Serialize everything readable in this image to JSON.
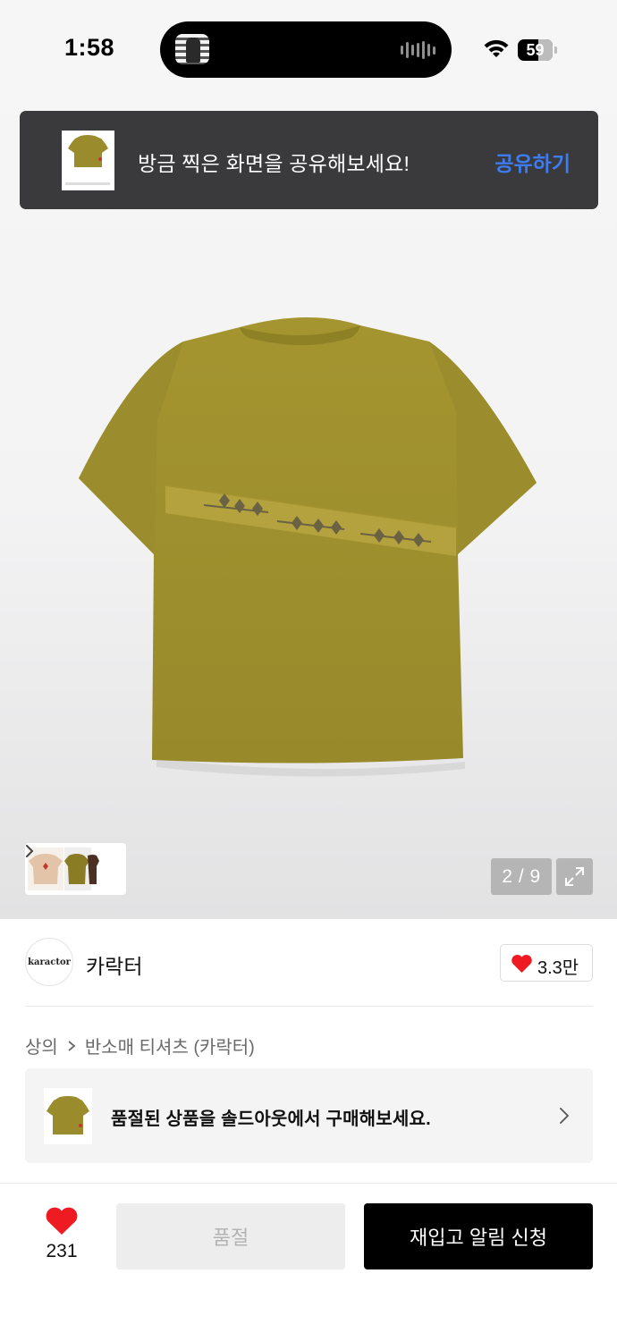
{
  "status_bar": {
    "time": "1:58",
    "battery_level": "59"
  },
  "share_toast": {
    "message": "방금 찍은 화면을 공유해보세요!",
    "action_label": "공유하기"
  },
  "gallery": {
    "page_indicator": "2 / 9"
  },
  "brand": {
    "logo_text": "karactor",
    "name": "카락터",
    "like_count": "3.3만"
  },
  "breadcrumb": {
    "category": "상의",
    "subcategory": "반소매 티셔츠 (카락터)"
  },
  "soldout_banner": {
    "message": "품절된 상품을 솔드아웃에서 구매해보세요."
  },
  "bottom_bar": {
    "like_count": "231",
    "soldout_label": "품절",
    "restock_label": "재입고 알림 신청"
  },
  "colors": {
    "product_olive": "#9a8b2c",
    "accent_blue": "#3d7cf2",
    "heart_red": "#ef1b23"
  }
}
